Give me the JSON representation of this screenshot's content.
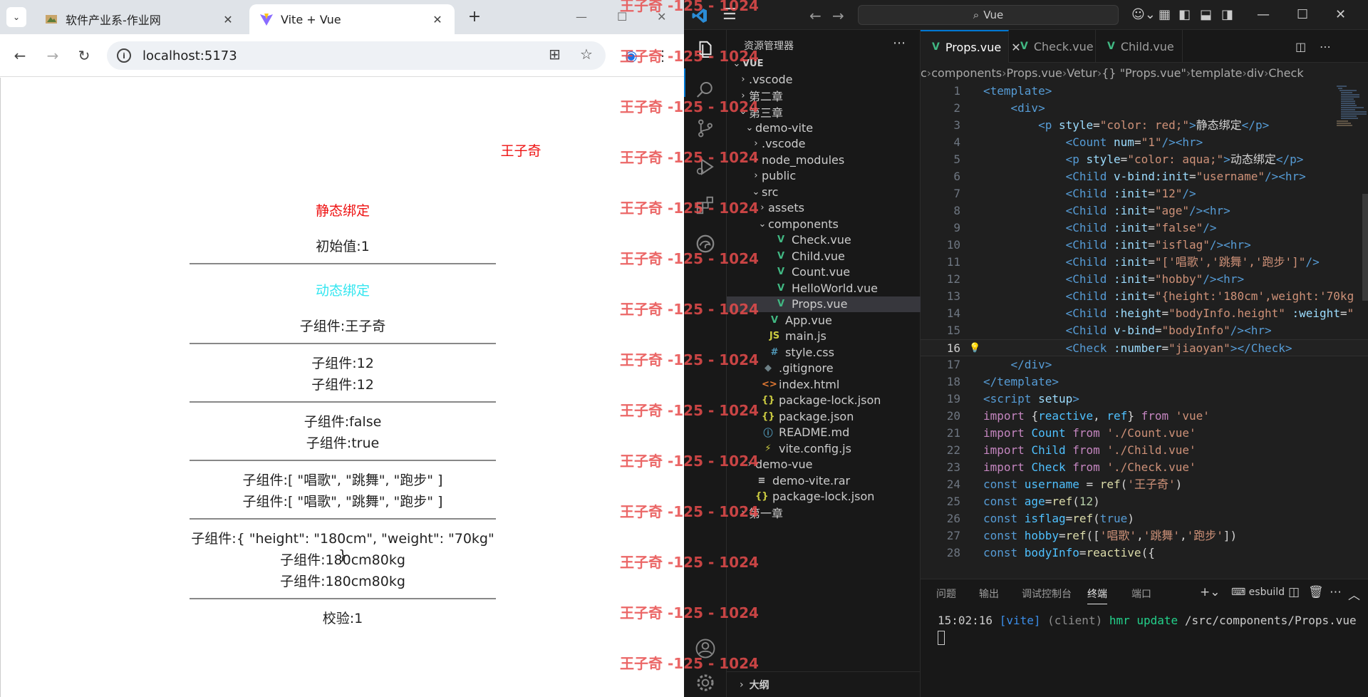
{
  "browser": {
    "tabs": [
      {
        "title": "软件产业系-作业网",
        "active": false
      },
      {
        "title": "Vite + Vue",
        "active": true
      }
    ],
    "new_tab": "+",
    "url": "localhost:5173",
    "page": {
      "top_name": "王子奇",
      "static_title": "静态绑定",
      "count_initial": "初始值:1",
      "dynamic_title": "动态绑定",
      "child_username": "子组件:王子奇",
      "child_12_a": "子组件:12",
      "child_12_b": "子组件:12",
      "child_false": "子组件:false",
      "child_true": "子组件:true",
      "child_array_a": "子组件:[ \"唱歌\", \"跳舞\", \"跑步\" ]",
      "child_array_b": "子组件:[ \"唱歌\", \"跳舞\", \"跑步\" ]",
      "child_object": "子组件:{ \"height\": \"180cm\", \"weight\": \"70kg\" }",
      "child_height_a": "子组件:180cm80kg",
      "child_height_b": "子组件:180cm80kg",
      "check": "校验:1",
      "colors": {
        "red": "#ee1111",
        "aqua": "#33e6f0"
      }
    }
  },
  "vscode": {
    "search": "Vue",
    "explorer_title": "资源管理器",
    "outline_label": "大纲",
    "tree": [
      {
        "label": "VUE",
        "depth": 0,
        "chev": "v",
        "bold": true
      },
      {
        "label": ".vscode",
        "depth": 1,
        "chev": ">"
      },
      {
        "label": "第二章",
        "depth": 1,
        "chev": ">"
      },
      {
        "label": "第三章",
        "depth": 1,
        "chev": "v"
      },
      {
        "label": "demo-vite",
        "depth": 2,
        "chev": "v"
      },
      {
        "label": ".vscode",
        "depth": 3,
        "chev": ">"
      },
      {
        "label": "node_modules",
        "depth": 3,
        "chev": ">"
      },
      {
        "label": "public",
        "depth": 3,
        "chev": ">"
      },
      {
        "label": "src",
        "depth": 3,
        "chev": "v"
      },
      {
        "label": "assets",
        "depth": 4,
        "chev": ">"
      },
      {
        "label": "components",
        "depth": 4,
        "chev": "v"
      },
      {
        "label": "Check.vue",
        "depth": 5,
        "icon": "V",
        "type": "vue"
      },
      {
        "label": "Child.vue",
        "depth": 5,
        "icon": "V",
        "type": "vue"
      },
      {
        "label": "Count.vue",
        "depth": 5,
        "icon": "V",
        "type": "vue"
      },
      {
        "label": "HelloWorld.vue",
        "depth": 5,
        "icon": "V",
        "type": "vue"
      },
      {
        "label": "Props.vue",
        "depth": 5,
        "icon": "V",
        "type": "vue",
        "selected": true
      },
      {
        "label": "App.vue",
        "depth": 4,
        "icon": "V",
        "type": "vue"
      },
      {
        "label": "main.js",
        "depth": 4,
        "icon": "JS",
        "type": "js"
      },
      {
        "label": "style.css",
        "depth": 4,
        "icon": "#",
        "type": "css"
      },
      {
        "label": ".gitignore",
        "depth": 3,
        "icon": "◆",
        "type": "git"
      },
      {
        "label": "index.html",
        "depth": 3,
        "icon": "<>",
        "type": "html"
      },
      {
        "label": "package-lock.json",
        "depth": 3,
        "icon": "{}",
        "type": "json"
      },
      {
        "label": "package.json",
        "depth": 3,
        "icon": "{}",
        "type": "json"
      },
      {
        "label": "README.md",
        "depth": 3,
        "icon": "ⓘ",
        "type": "md"
      },
      {
        "label": "vite.config.js",
        "depth": 3,
        "icon": "⚡",
        "type": "js"
      },
      {
        "label": "demo-vue",
        "depth": 2,
        "chev": ">"
      },
      {
        "label": "demo-vite.rar",
        "depth": 2,
        "icon": "≡",
        "type": "rar"
      },
      {
        "label": "package-lock.json",
        "depth": 2,
        "icon": "{}",
        "type": "json"
      },
      {
        "label": "第一章",
        "depth": 1,
        "chev": ">"
      }
    ],
    "editor_tabs": [
      {
        "label": "Props.vue",
        "active": true
      },
      {
        "label": "Check.vue",
        "active": false
      },
      {
        "label": "Child.vue",
        "active": false
      }
    ],
    "breadcrumbs": [
      "c",
      "components",
      "Props.vue",
      "Vetur",
      "{} \"Props.vue\"",
      "template",
      "div",
      "Check"
    ],
    "code_lines": [
      [
        [
          "tg",
          "<template>"
        ]
      ],
      [
        [
          "tx",
          "    "
        ],
        [
          "tg",
          "<div>"
        ]
      ],
      [
        [
          "tx",
          "        "
        ],
        [
          "tg",
          "<p "
        ],
        [
          "at",
          "style"
        ],
        [
          "tx",
          "="
        ],
        [
          "st",
          "\"color: red;\""
        ],
        [
          "tg",
          ">"
        ],
        [
          "tx",
          "静态绑定"
        ],
        [
          "tg",
          "</p>"
        ]
      ],
      [
        [
          "tx",
          "            "
        ],
        [
          "tg",
          "<Count "
        ],
        [
          "at",
          "num"
        ],
        [
          "tx",
          "="
        ],
        [
          "st",
          "\"1\""
        ],
        [
          "tg",
          "/><hr>"
        ]
      ],
      [
        [
          "tx",
          "            "
        ],
        [
          "tg",
          "<p "
        ],
        [
          "at",
          "style"
        ],
        [
          "tx",
          "="
        ],
        [
          "st",
          "\"color: aqua;\""
        ],
        [
          "tg",
          ">"
        ],
        [
          "tx",
          "动态绑定"
        ],
        [
          "tg",
          "</p>"
        ]
      ],
      [
        [
          "tx",
          "            "
        ],
        [
          "tg",
          "<Child "
        ],
        [
          "at",
          "v-bind:init"
        ],
        [
          "tx",
          "="
        ],
        [
          "st",
          "\"username\""
        ],
        [
          "tg",
          "/><hr>"
        ]
      ],
      [
        [
          "tx",
          "            "
        ],
        [
          "tg",
          "<Child "
        ],
        [
          "at",
          ":init"
        ],
        [
          "tx",
          "="
        ],
        [
          "st",
          "\"12\""
        ],
        [
          "tg",
          "/>"
        ]
      ],
      [
        [
          "tx",
          "            "
        ],
        [
          "tg",
          "<Child "
        ],
        [
          "at",
          ":init"
        ],
        [
          "tx",
          "="
        ],
        [
          "st",
          "\"age\""
        ],
        [
          "tg",
          "/><hr>"
        ]
      ],
      [
        [
          "tx",
          "            "
        ],
        [
          "tg",
          "<Child "
        ],
        [
          "at",
          ":init"
        ],
        [
          "tx",
          "="
        ],
        [
          "st",
          "\"false\""
        ],
        [
          "tg",
          "/>"
        ]
      ],
      [
        [
          "tx",
          "            "
        ],
        [
          "tg",
          "<Child "
        ],
        [
          "at",
          ":init"
        ],
        [
          "tx",
          "="
        ],
        [
          "st",
          "\"isflag\""
        ],
        [
          "tg",
          "/><hr>"
        ]
      ],
      [
        [
          "tx",
          "            "
        ],
        [
          "tg",
          "<Child "
        ],
        [
          "at",
          ":init"
        ],
        [
          "tx",
          "="
        ],
        [
          "st",
          "\"['唱歌','跳舞','跑步']\""
        ],
        [
          "tg",
          "/>"
        ]
      ],
      [
        [
          "tx",
          "            "
        ],
        [
          "tg",
          "<Child "
        ],
        [
          "at",
          ":init"
        ],
        [
          "tx",
          "="
        ],
        [
          "st",
          "\"hobby\""
        ],
        [
          "tg",
          "/><hr>"
        ]
      ],
      [
        [
          "tx",
          "            "
        ],
        [
          "tg",
          "<Child "
        ],
        [
          "at",
          ":init"
        ],
        [
          "tx",
          "="
        ],
        [
          "st",
          "\"{height:'180cm',weight:'70kg"
        ]
      ],
      [
        [
          "tx",
          "            "
        ],
        [
          "tg",
          "<Child "
        ],
        [
          "at",
          ":height"
        ],
        [
          "tx",
          "="
        ],
        [
          "st",
          "\"bodyInfo.height\""
        ],
        [
          "tx",
          " "
        ],
        [
          "at",
          ":weight"
        ],
        [
          "tx",
          "="
        ],
        [
          "st",
          "\""
        ]
      ],
      [
        [
          "tx",
          "            "
        ],
        [
          "tg",
          "<Child "
        ],
        [
          "at",
          "v-bind"
        ],
        [
          "tx",
          "="
        ],
        [
          "st",
          "\"bodyInfo\""
        ],
        [
          "tg",
          "/><hr>"
        ]
      ],
      [
        [
          "tx",
          "            "
        ],
        [
          "tg",
          "<Check "
        ],
        [
          "at",
          ":number"
        ],
        [
          "tx",
          "="
        ],
        [
          "st",
          "\"jiaoyan\""
        ],
        [
          "tg",
          "></Check>"
        ]
      ],
      [
        [
          "tx",
          "    "
        ],
        [
          "tg",
          "</div>"
        ]
      ],
      [
        [
          "tg",
          "</template>"
        ]
      ],
      [
        [
          "tg",
          "<script "
        ],
        [
          "at",
          "setup"
        ],
        [
          "tg",
          ">"
        ]
      ],
      [
        [
          "kw",
          "import "
        ],
        [
          "tx",
          "{"
        ],
        [
          "vr",
          "reactive"
        ],
        [
          "tx",
          ", "
        ],
        [
          "vr",
          "ref"
        ],
        [
          "tx",
          "} "
        ],
        [
          "kw",
          "from "
        ],
        [
          "st",
          "'vue'"
        ]
      ],
      [
        [
          "kw",
          "import "
        ],
        [
          "vr",
          "Count "
        ],
        [
          "kw",
          "from "
        ],
        [
          "st",
          "'./Count.vue'"
        ]
      ],
      [
        [
          "kw",
          "import "
        ],
        [
          "vr",
          "Child "
        ],
        [
          "kw",
          "from "
        ],
        [
          "st",
          "'./Child.vue'"
        ]
      ],
      [
        [
          "kw",
          "import "
        ],
        [
          "vr",
          "Check "
        ],
        [
          "kw",
          "from "
        ],
        [
          "st",
          "'./Check.vue'"
        ]
      ],
      [
        [
          "bl",
          "const "
        ],
        [
          "vr",
          "username "
        ],
        [
          "tx",
          "= "
        ],
        [
          "fn",
          "ref"
        ],
        [
          "tx",
          "("
        ],
        [
          "st",
          "'王子奇'"
        ],
        [
          "tx",
          ")"
        ]
      ],
      [
        [
          "bl",
          "const "
        ],
        [
          "vr",
          "age"
        ],
        [
          "tx",
          "="
        ],
        [
          "fn",
          "ref"
        ],
        [
          "tx",
          "("
        ],
        [
          "nm",
          "12"
        ],
        [
          "tx",
          ")"
        ]
      ],
      [
        [
          "bl",
          "const "
        ],
        [
          "vr",
          "isflag"
        ],
        [
          "tx",
          "="
        ],
        [
          "fn",
          "ref"
        ],
        [
          "tx",
          "("
        ],
        [
          "bl",
          "true"
        ],
        [
          "tx",
          ")"
        ]
      ],
      [
        [
          "bl",
          "const "
        ],
        [
          "vr",
          "hobby"
        ],
        [
          "tx",
          "="
        ],
        [
          "fn",
          "ref"
        ],
        [
          "tx",
          "(["
        ],
        [
          "st",
          "'唱歌'"
        ],
        [
          "tx",
          ","
        ],
        [
          "st",
          "'跳舞'"
        ],
        [
          "tx",
          ","
        ],
        [
          "st",
          "'跑步'"
        ],
        [
          "tx",
          "])"
        ]
      ],
      [
        [
          "bl",
          "const "
        ],
        [
          "vr",
          "bodyInfo"
        ],
        [
          "tx",
          "="
        ],
        [
          "fn",
          "reactive"
        ],
        [
          "tx",
          "({"
        ]
      ]
    ],
    "line_numbers": [
      "1",
      "2",
      "3",
      "4",
      "5",
      "6",
      "7",
      "8",
      "9",
      "10",
      "11",
      "12",
      "13",
      "14",
      "15",
      "16",
      "17",
      "18",
      "19",
      "20",
      "21",
      "22",
      "23",
      "24",
      "25",
      "26",
      "27",
      "28"
    ],
    "current_line": 16,
    "panel_tabs": [
      "问题",
      "输出",
      "调试控制台",
      "终端",
      "端口"
    ],
    "panel_active": "终端",
    "terminal_profile": "esbuild",
    "terminal_line": [
      [
        "tx",
        "15:02:16 "
      ],
      [
        "bl",
        "[vite] "
      ],
      [
        "gr",
        "(client) "
      ],
      [
        "ok",
        "hmr update "
      ],
      [
        "tx",
        "/src/components/Props.vue"
      ]
    ]
  },
  "watermark": {
    "text": "王子奇 -125 - 1024",
    "count": 14
  }
}
